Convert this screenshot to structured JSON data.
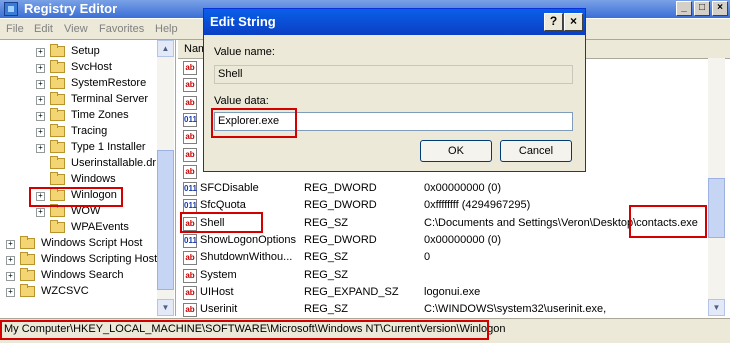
{
  "window": {
    "title": "Registry Editor",
    "min": "_",
    "max": "□",
    "close": "×"
  },
  "menu": [
    "File",
    "Edit",
    "View",
    "Favorites",
    "Help"
  ],
  "tree": {
    "items": [
      {
        "label": "Setup",
        "expand": "+",
        "indent": 1
      },
      {
        "label": "SvcHost",
        "expand": "+",
        "indent": 1
      },
      {
        "label": "SystemRestore",
        "expand": "+",
        "indent": 1
      },
      {
        "label": "Terminal Server",
        "expand": "+",
        "indent": 1
      },
      {
        "label": "Time Zones",
        "expand": "+",
        "indent": 1
      },
      {
        "label": "Tracing",
        "expand": "+",
        "indent": 1
      },
      {
        "label": "Type 1 Installer",
        "expand": "+",
        "indent": 1
      },
      {
        "label": "Userinstallable.dr",
        "expand": "",
        "indent": 1
      },
      {
        "label": "Windows",
        "expand": "",
        "indent": 1
      },
      {
        "label": "Winlogon",
        "expand": "+",
        "indent": 1
      },
      {
        "label": "WOW",
        "expand": "+",
        "indent": 1
      },
      {
        "label": "WPAEvents",
        "expand": "",
        "indent": 1
      },
      {
        "label": "Windows Script Host",
        "expand": "+",
        "indent": 0
      },
      {
        "label": "Windows Scripting Host",
        "expand": "+",
        "indent": 0
      },
      {
        "label": "Windows Search",
        "expand": "+",
        "indent": 0
      },
      {
        "label": "WZCSVC",
        "expand": "+",
        "indent": 0
      }
    ]
  },
  "list": {
    "header_name": "Nam",
    "rows": [
      {
        "name": "",
        "type": "",
        "data": "",
        "icon": "sz"
      },
      {
        "name": "",
        "type": "",
        "data": "",
        "icon": "sz"
      },
      {
        "name": "",
        "type": "",
        "data": "",
        "icon": "sz"
      },
      {
        "name": "",
        "type": "",
        "data": "",
        "icon": "dw"
      },
      {
        "name": "",
        "type": "",
        "data": "",
        "icon": "sz"
      },
      {
        "name": "",
        "type": "",
        "data": "",
        "icon": "sz"
      },
      {
        "name": "",
        "type": "",
        "data": "",
        "icon": "sz"
      },
      {
        "name": "SFCDisable",
        "type": "REG_DWORD",
        "data": "0x00000000 (0)",
        "icon": "dw"
      },
      {
        "name": "SfcQuota",
        "type": "REG_DWORD",
        "data": "0xffffffff (4294967295)",
        "icon": "dw"
      },
      {
        "name": "Shell",
        "type": "REG_SZ",
        "data": "C:\\Documents and Settings\\Veron\\Desktop\\contacts.exe",
        "icon": "sz"
      },
      {
        "name": "ShowLogonOptions",
        "type": "REG_DWORD",
        "data": "0x00000000 (0)",
        "icon": "dw"
      },
      {
        "name": "ShutdownWithou...",
        "type": "REG_SZ",
        "data": "0",
        "icon": "sz"
      },
      {
        "name": "System",
        "type": "REG_SZ",
        "data": "",
        "icon": "sz"
      },
      {
        "name": "UIHost",
        "type": "REG_EXPAND_SZ",
        "data": "logonui.exe",
        "icon": "sz"
      },
      {
        "name": "Userinit",
        "type": "REG_SZ",
        "data": "C:\\WINDOWS\\system32\\userinit.exe,",
        "icon": "sz"
      }
    ]
  },
  "status": {
    "path": "My Computer\\HKEY_LOCAL_MACHINE\\SOFTWARE\\Microsoft\\Windows NT\\CurrentVersion\\Winlogon"
  },
  "dialog": {
    "title": "Edit String",
    "help": "?",
    "close": "×",
    "value_name_label": "Value name:",
    "value_name": "Shell",
    "value_data_label": "Value data:",
    "value_data": "Explorer.exe",
    "ok": "OK",
    "cancel": "Cancel"
  },
  "icons": {
    "sz": "ab",
    "dw": "011"
  },
  "colors": {
    "highlight_box": "#d40000",
    "title_bar": "#0a5fe8"
  }
}
